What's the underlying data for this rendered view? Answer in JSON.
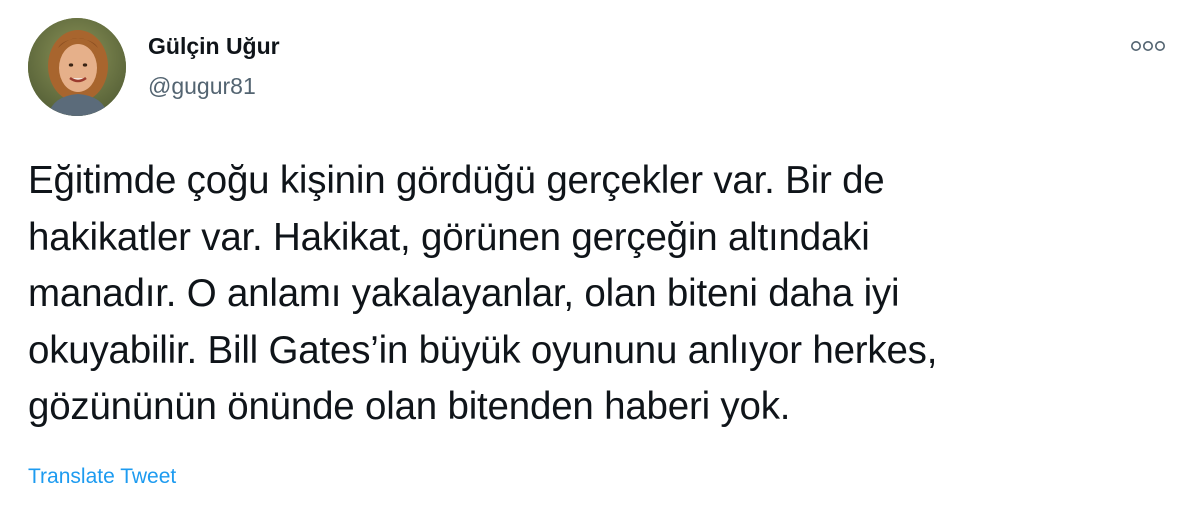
{
  "author": {
    "display_name": "Gülçin Uğur",
    "handle": "@gugur81",
    "avatar_icon": "profile-photo"
  },
  "more_icon": "more-options-icon",
  "tweet": {
    "text": "Eğitimde çoğu kişinin gördüğü gerçekler var. Bir de\nhakikatler var. Hakikat, görünen gerçeğin altındaki\nmanadır. O anlamı yakalayanlar, olan biteni daha iyi\nokuyabilir. Bill Gates’in büyük oyununu anlıyor herkes,\ngözününün önünde olan bitenden haberi yok."
  },
  "actions": {
    "translate_label": "Translate Tweet"
  },
  "colors": {
    "text": "#0f1419",
    "secondary": "#536471",
    "link": "#1d9bf0"
  }
}
